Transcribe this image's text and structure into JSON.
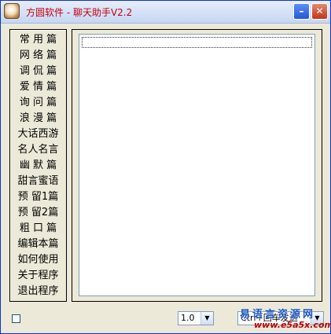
{
  "window": {
    "title": "方圆软件 - 聊天助手V2.2",
    "minimize_label": "–",
    "close_label": "✕"
  },
  "sidebar": {
    "items": [
      {
        "label": "常 用 篇"
      },
      {
        "label": "网 络 篇"
      },
      {
        "label": "调 侃 篇"
      },
      {
        "label": "爱 情 篇"
      },
      {
        "label": "询 问 篇"
      },
      {
        "label": "浪 漫 篇"
      },
      {
        "label": "大话西游"
      },
      {
        "label": "名人名言"
      },
      {
        "label": "幽 默 篇"
      },
      {
        "label": "甜言蜜语"
      },
      {
        "label": "预 留1篇"
      },
      {
        "label": "预 留2篇"
      },
      {
        "label": "粗 口 篇"
      },
      {
        "label": "编辑本篇"
      },
      {
        "label": "如何使用"
      },
      {
        "label": "关于程序"
      },
      {
        "label": "退出程序"
      }
    ]
  },
  "content": {
    "input_value": ""
  },
  "bottom": {
    "speed_value": "1.0",
    "mode_value": "Ctrl+回车发送"
  },
  "watermark": {
    "line1": "易语言资源网",
    "line2": "www.e5a5x.com"
  },
  "colors": {
    "title_text": "#c5000b",
    "window_bg": "#ece9d8",
    "frame_border": "#0831d9"
  }
}
